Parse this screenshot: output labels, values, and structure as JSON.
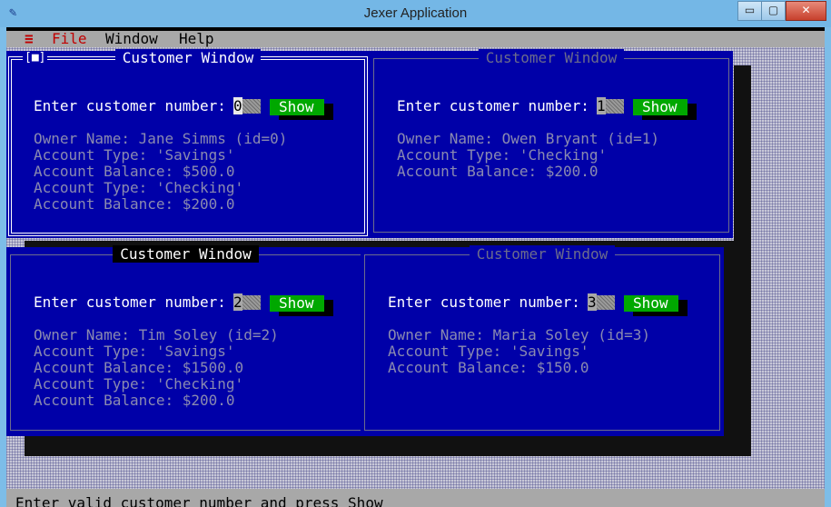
{
  "app_title": "Jexer Application",
  "window_controls": {
    "minimize": "▭",
    "maximize": "▢",
    "close": "✕"
  },
  "menu": {
    "system_icon": "≡",
    "file": "File",
    "window": "Window",
    "help": "Help"
  },
  "status_text": "Enter valid customer number and press Show",
  "windows": [
    {
      "title": "Customer Window",
      "active": true,
      "close_box": "[■]",
      "prompt": "Enter customer number:",
      "customer_number": "0",
      "show_label": "Show",
      "lines": [
        "Owner Name: Jane Simms (id=0)",
        "Account Type: 'Savings'",
        "Account Balance: $500.0",
        "Account Type: 'Checking'",
        "Account Balance: $200.0"
      ]
    },
    {
      "title": "Customer Window",
      "active": false,
      "prompt": "Enter customer number:",
      "customer_number": "1",
      "show_label": "Show",
      "lines": [
        "Owner Name: Owen Bryant (id=1)",
        "Account Type: 'Checking'",
        "Account Balance: $200.0"
      ]
    },
    {
      "title": "Customer Window",
      "active": false,
      "prompt": "Enter customer number:",
      "customer_number": "2",
      "show_label": "Show",
      "lines": [
        "Owner Name: Tim Soley (id=2)",
        "Account Type: 'Savings'",
        "Account Balance: $1500.0",
        "Account Type: 'Checking'",
        "Account Balance: $200.0"
      ]
    },
    {
      "title": "Customer Window",
      "active": false,
      "prompt": "Enter customer number:",
      "customer_number": "3",
      "show_label": "Show",
      "lines": [
        "Owner Name: Maria Soley (id=3)",
        "Account Type: 'Savings'",
        "Account Balance: $150.0"
      ]
    }
  ]
}
